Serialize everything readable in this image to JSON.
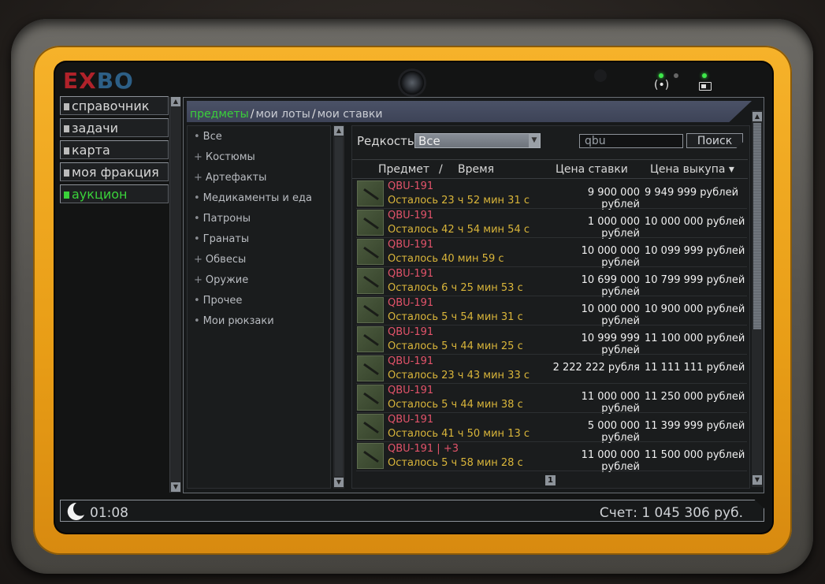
{
  "logo": {
    "part1": "EX",
    "part2": "BO"
  },
  "nav": {
    "items": [
      {
        "label": "справочник"
      },
      {
        "label": "задачи"
      },
      {
        "label": "карта"
      },
      {
        "label": "моя фракция"
      },
      {
        "label": "аукцион"
      }
    ],
    "active_index": 4
  },
  "tabs": {
    "items": [
      "предметы",
      "мои лоты",
      "мои ставки"
    ],
    "separator": "/",
    "selected_index": 0
  },
  "categories": [
    {
      "prefix": "•",
      "label": "Все"
    },
    {
      "prefix": "+",
      "label": "Костюмы"
    },
    {
      "prefix": "+",
      "label": "Артефакты"
    },
    {
      "prefix": "•",
      "label": "Медикаменты и еда"
    },
    {
      "prefix": "•",
      "label": "Патроны"
    },
    {
      "prefix": "•",
      "label": "Гранаты"
    },
    {
      "prefix": "+",
      "label": "Обвесы"
    },
    {
      "prefix": "+",
      "label": "Оружие"
    },
    {
      "prefix": "•",
      "label": "Прочее"
    },
    {
      "prefix": "•",
      "label": "Мои рюкзаки"
    }
  ],
  "filter": {
    "rarity_label": "Редкость",
    "rarity_value": "Все",
    "search_value": "qbu",
    "search_button": "Поиск"
  },
  "table": {
    "headers": {
      "item": "Предмет",
      "slash": "/",
      "time": "Время",
      "bid": "Цена ставки",
      "buyout": "Цена выкупа ▾"
    },
    "rows": [
      {
        "name": "QBU-191",
        "time": "Осталось 23 ч 52 мин 31 с",
        "bid": "9 900 000 рублей",
        "buyout": "9 949 999 рублей"
      },
      {
        "name": "QBU-191",
        "time": "Осталось 42 ч 54 мин 54 с",
        "bid": "1 000 000 рублей",
        "buyout": "10 000 000 рублей"
      },
      {
        "name": "QBU-191",
        "time": "Осталось 40 мин 59 с",
        "bid": "10 000 000 рублей",
        "buyout": "10 099 999 рублей"
      },
      {
        "name": "QBU-191",
        "time": "Осталось 6 ч 25 мин 53 с",
        "bid": "10 699 000 рублей",
        "buyout": "10 799 999 рублей"
      },
      {
        "name": "QBU-191",
        "time": "Осталось 5 ч 54 мин 31 с",
        "bid": "10 000 000 рублей",
        "buyout": "10 900 000 рублей"
      },
      {
        "name": "QBU-191",
        "time": "Осталось 5 ч 44 мин 25 с",
        "bid": "10 999 999 рублей",
        "buyout": "11 100 000 рублей"
      },
      {
        "name": "QBU-191",
        "time": "Осталось 23 ч 43 мин 33 с",
        "bid": "2 222 222 рубля",
        "buyout": "11 111 111 рублей"
      },
      {
        "name": "QBU-191",
        "time": "Осталось 5 ч 44 мин 38 с",
        "bid": "11 000 000 рублей",
        "buyout": "11 250 000 рублей"
      },
      {
        "name": "QBU-191",
        "time": "Осталось 41 ч 50 мин 13 с",
        "bid": "5 000 000 рублей",
        "buyout": "11 399 999 рублей"
      },
      {
        "name": "QBU-191 | +3",
        "time": "Осталось 5 ч 58 мин 28 с",
        "bid": "11 000 000 рублей",
        "buyout": "11 500 000 рублей"
      }
    ]
  },
  "pagination": {
    "current_page": "1"
  },
  "status": {
    "clock": "01:08",
    "balance": "Счет: 1 045 306 руб."
  },
  "colors": {
    "accent_green": "#3ad13a",
    "item_name": "#e2536a",
    "time_left": "#d9b53a",
    "rim_yellow": "#f6b22a"
  }
}
